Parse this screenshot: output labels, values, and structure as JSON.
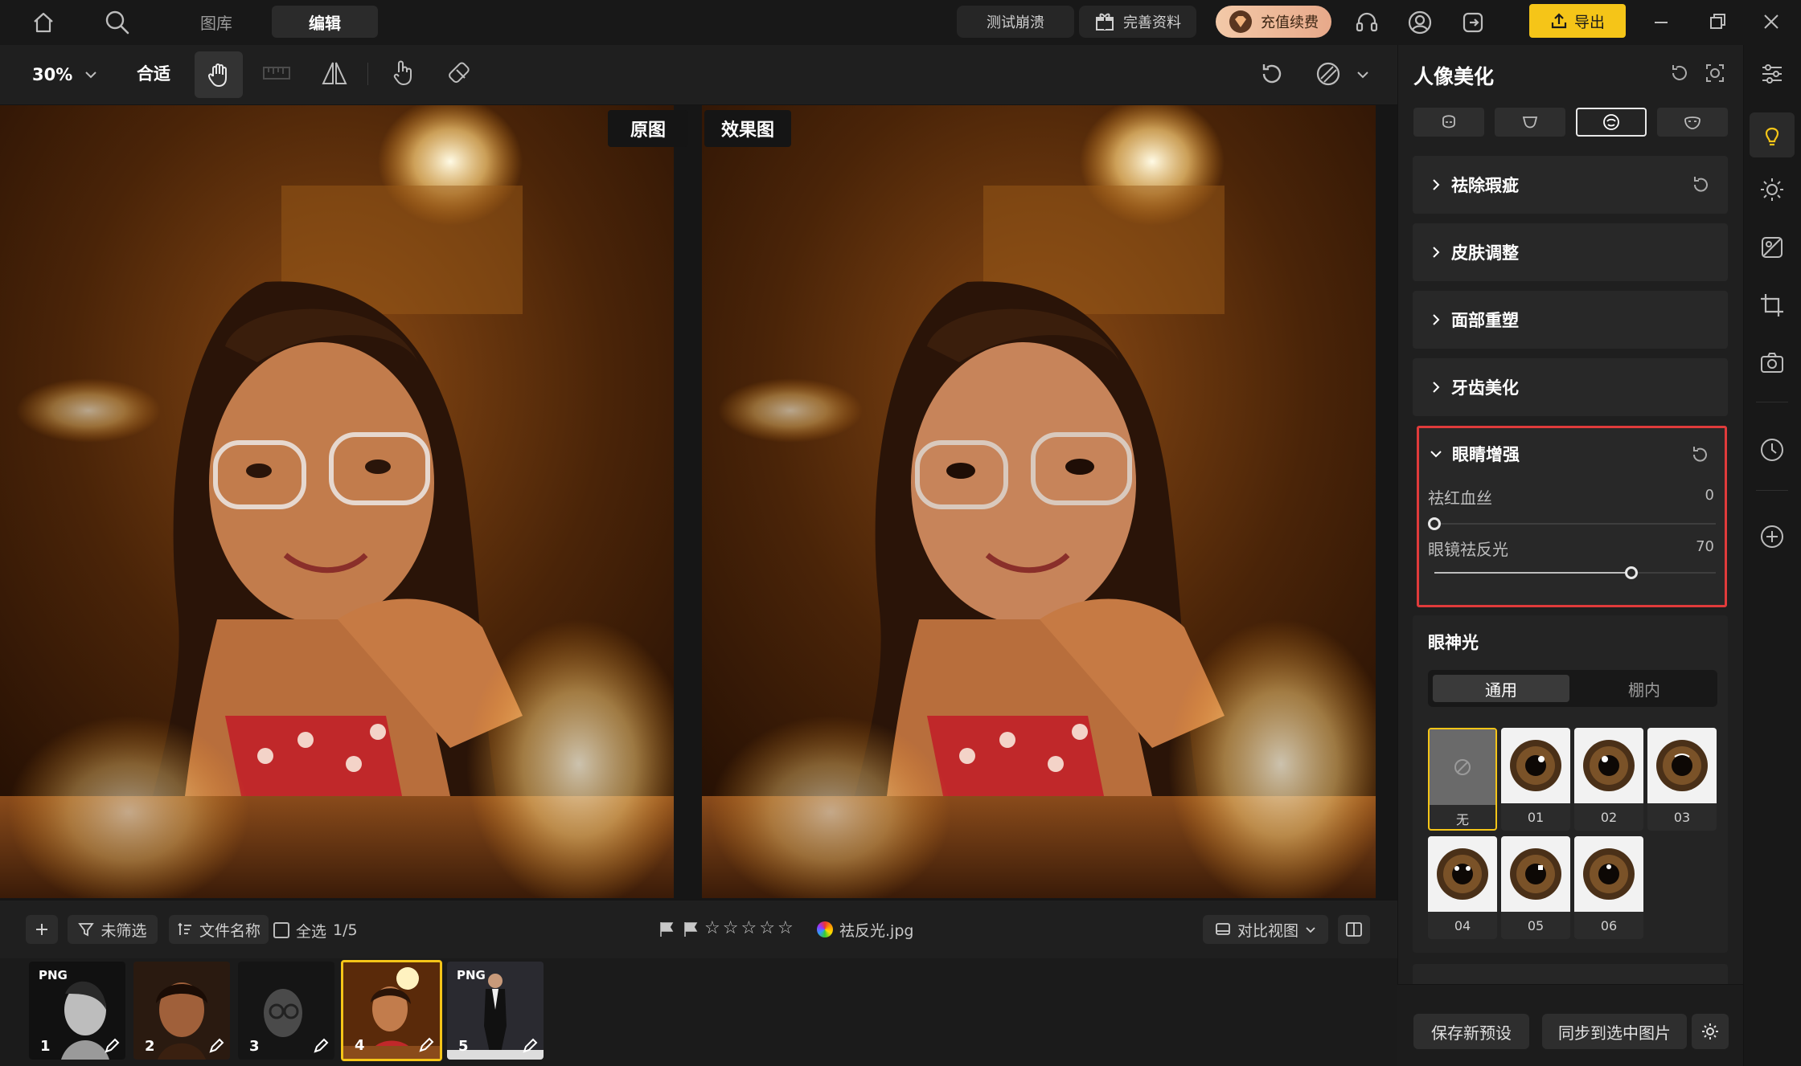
{
  "top_nav": {
    "tab_library": "图库",
    "tab_edit": "编辑",
    "btn_test": "测试崩溃",
    "btn_profile": "完善资料",
    "btn_recharge": "充值续费",
    "btn_export": "导出"
  },
  "toolbar": {
    "zoom": "30%",
    "fit": "合适"
  },
  "viewer": {
    "label_original": "原图",
    "label_result": "效果图"
  },
  "bottom_bar": {
    "filter": "未筛选",
    "sort": "文件名称",
    "select_all": "全选",
    "selection_count": "1/5",
    "filename": "祛反光.jpg",
    "view_mode": "对比视图",
    "rating_stars": 0
  },
  "filmstrip": {
    "items": [
      {
        "num": "1",
        "badge": "PNG"
      },
      {
        "num": "2",
        "badge": ""
      },
      {
        "num": "3",
        "badge": ""
      },
      {
        "num": "4",
        "badge": ""
      },
      {
        "num": "5",
        "badge": "PNG"
      }
    ],
    "selected_index": 4
  },
  "panel": {
    "title": "人像美化",
    "sections": [
      {
        "label": "祛除瑕疵"
      },
      {
        "label": "皮肤调整"
      },
      {
        "label": "面部重塑"
      },
      {
        "label": "牙齿美化"
      }
    ],
    "eye_section": {
      "label": "眼睛增强",
      "sliders": [
        {
          "label": "祛红血丝",
          "value": "0",
          "level": 0
        },
        {
          "label": "眼镜祛反光",
          "value": "70",
          "level": 0.7
        }
      ]
    },
    "catchlight": {
      "title": "眼神光",
      "tabs": [
        "通用",
        "棚内"
      ],
      "active_tab": 0,
      "presets": [
        "无",
        "01",
        "02",
        "03",
        "04",
        "05",
        "06"
      ],
      "selected_preset": 0
    },
    "btn_save_preset": "保存新预设",
    "btn_sync": "同步到选中图片"
  },
  "colors": {
    "accent_yellow": "#f5c518",
    "highlight_red": "#e03b3b",
    "panel_bg": "#1f1f1f"
  }
}
